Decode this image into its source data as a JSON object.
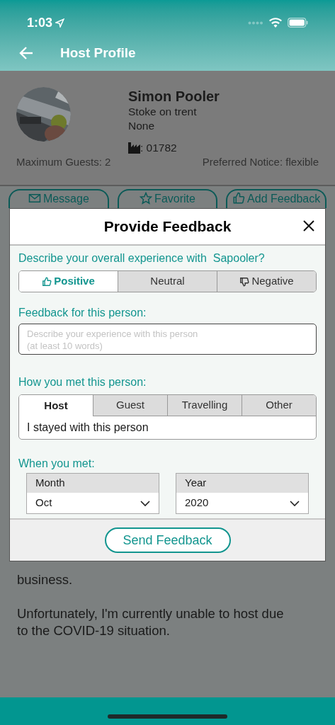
{
  "status_bar": {
    "time": "1:03"
  },
  "header": {
    "title": "Host Profile"
  },
  "profile": {
    "name": "Simon Pooler",
    "location": "Stoke on trent",
    "line_3": "None",
    "phone": ": 01782",
    "max_guests": "Maximum Guests: 2",
    "notice": "Preferred Notice: flexible"
  },
  "actions": [
    {
      "label": "Message",
      "kind": "mail"
    },
    {
      "label": "Favorite",
      "kind": "star"
    },
    {
      "label": "Add Feedback",
      "kind": "thumb"
    }
  ],
  "about_paragraphs": [
    [
      "business."
    ],
    [
      "Unfortunately, I'm currently unable to host due",
      "to the COVID-19 situation."
    ]
  ],
  "modal": {
    "title": "Provide Feedback",
    "question": "Describe your overall experience with  Sapooler?",
    "ratings": [
      {
        "label": "Positive",
        "kind": "up",
        "selected": true
      },
      {
        "label": "Neutral",
        "kind": "none",
        "selected": false
      },
      {
        "label": "Negative",
        "kind": "down",
        "selected": false
      }
    ],
    "feedback_label": "Feedback for this person:",
    "feedback_placeholder": "Describe your experience with this person\n(at least 10 words)",
    "met_label": "How you met this person:",
    "met_tabs": [
      {
        "label": "Host",
        "selected": true
      },
      {
        "label": "Guest",
        "selected": false
      },
      {
        "label": "Travelling",
        "selected": false
      },
      {
        "label": "Other",
        "selected": false
      }
    ],
    "met_value": "I stayed with this person",
    "when_label": "When you met:",
    "selects": [
      {
        "label": "Month",
        "value": "Oct"
      },
      {
        "label": "Year",
        "value": "2020"
      }
    ],
    "send": "Send Feedback"
  }
}
